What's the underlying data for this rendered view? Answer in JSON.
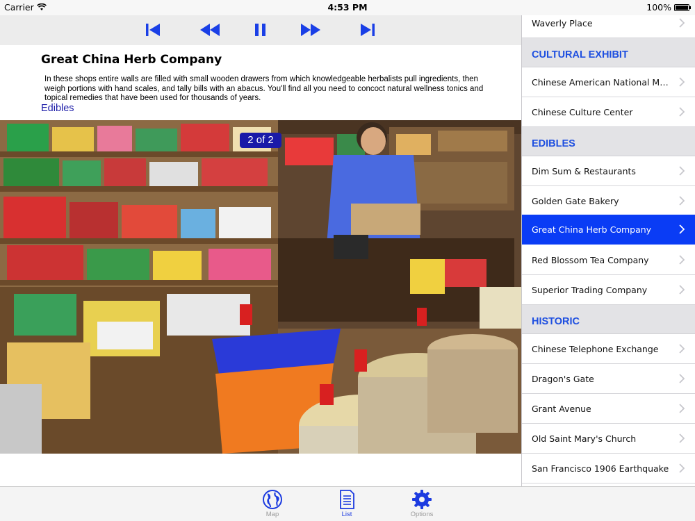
{
  "status_bar": {
    "carrier": "Carrier",
    "time": "4:53 PM",
    "battery": "100%"
  },
  "toolbar": {
    "buttons": [
      {
        "name": "skip-to-start",
        "icon": "skip-back-icon"
      },
      {
        "name": "rewind",
        "icon": "rewind-icon"
      },
      {
        "name": "pause",
        "icon": "pause-icon"
      },
      {
        "name": "fast-forward",
        "icon": "fast-forward-icon"
      },
      {
        "name": "skip-to-end",
        "icon": "skip-forward-icon"
      }
    ],
    "color": "#1a3fe6"
  },
  "detail": {
    "title": "Great China Herb Company",
    "description": "In these shops entire walls are filled with small wooden drawers from which knowledgeable herbalists pull ingredients, then weigh portions with hand scales, and tally bills with an abacus. You'll find all you need to concoct natural wellness tonics and topical remedies that have been used for thousands of years.",
    "category": "Edibles",
    "photo_counter": "2 of 2"
  },
  "list": {
    "accent": "#1e4fe0",
    "selected_color": "#0a3cf5",
    "entries": [
      {
        "kind": "row",
        "label": "Waverly Place"
      },
      {
        "kind": "section",
        "label": "CULTURAL EXHIBIT"
      },
      {
        "kind": "row",
        "label": "Chinese American National Museum"
      },
      {
        "kind": "row",
        "label": "Chinese Culture Center"
      },
      {
        "kind": "section",
        "label": "EDIBLES"
      },
      {
        "kind": "row",
        "label": "Dim Sum & Restaurants"
      },
      {
        "kind": "row",
        "label": "Golden Gate Bakery"
      },
      {
        "kind": "row",
        "label": "Great China Herb Company",
        "selected": true
      },
      {
        "kind": "row",
        "label": "Red Blossom Tea Company"
      },
      {
        "kind": "row",
        "label": "Superior Trading Company"
      },
      {
        "kind": "section",
        "label": "HISTORIC"
      },
      {
        "kind": "row",
        "label": "Chinese Telephone Exchange"
      },
      {
        "kind": "row",
        "label": "Dragon's Gate"
      },
      {
        "kind": "row",
        "label": "Grant Avenue"
      },
      {
        "kind": "row",
        "label": "Old Saint Mary's Church"
      },
      {
        "kind": "row",
        "label": "San Francisco 1906 Earthquake"
      }
    ]
  },
  "tabbar": {
    "tabs": [
      {
        "label": "Map",
        "icon": "globe-icon",
        "active": false
      },
      {
        "label": "List",
        "icon": "document-list-icon",
        "active": true
      },
      {
        "label": "Options",
        "icon": "gear-icon",
        "active": false
      }
    ]
  }
}
